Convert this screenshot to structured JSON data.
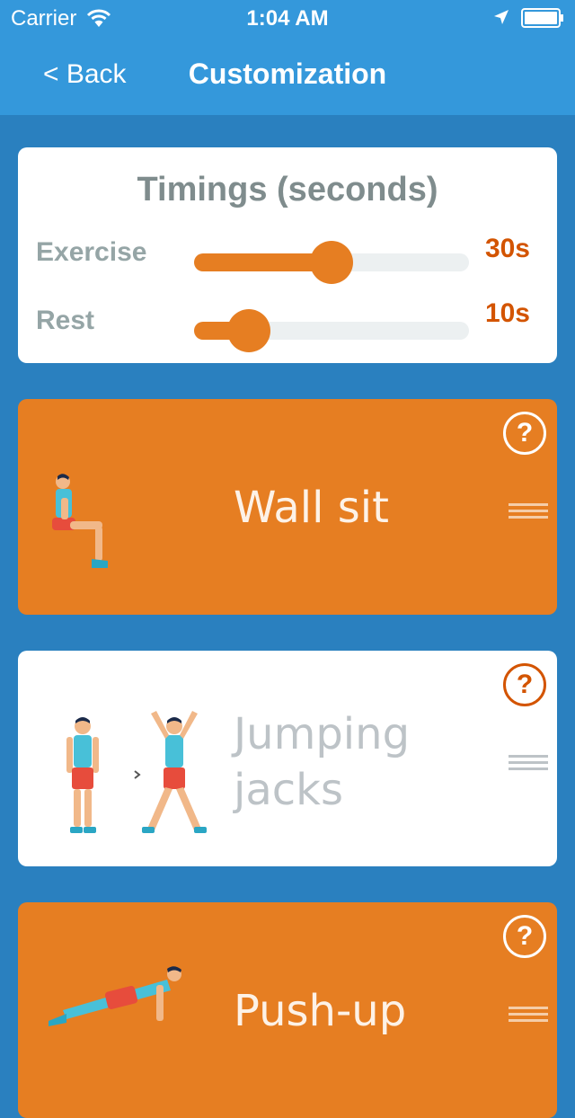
{
  "status_bar": {
    "carrier": "Carrier",
    "time": "1:04 AM"
  },
  "nav": {
    "back_label": "< Back",
    "title": "Customization"
  },
  "timings": {
    "title": "Timings (seconds)",
    "exercise": {
      "label": "Exercise",
      "value_text": "30s",
      "slider_level": 0.5
    },
    "rest": {
      "label": "Rest",
      "value_text": "10s",
      "slider_level": 0.2
    }
  },
  "exercises": [
    {
      "name": "Wall sit",
      "style": "orange",
      "icon": "wall-sit-figure-icon"
    },
    {
      "name": "Jumping jacks",
      "name_lines": [
        "Jumping",
        "jacks"
      ],
      "style": "white",
      "icon": "jumping-jacks-figure-icon"
    },
    {
      "name": "Push-up",
      "style": "orange",
      "icon": "push-up-figure-icon"
    }
  ],
  "help_label": "?",
  "colors": {
    "nav_blue": "#3498db",
    "background_blue": "#2a80bf",
    "accent_orange": "#e67e22",
    "value_orange": "#d35400"
  }
}
